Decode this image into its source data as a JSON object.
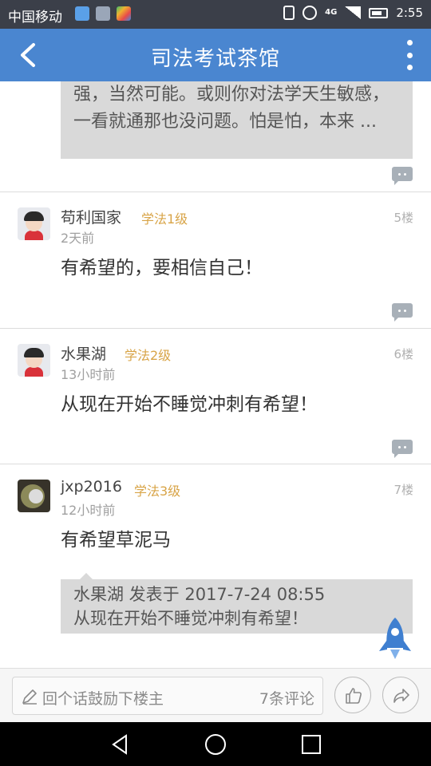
{
  "status_bar": {
    "carrier": "中国移动",
    "network": "4G",
    "time": "2:55"
  },
  "header": {
    "title": "司法考试茶馆",
    "back_icon": "chevron-left-icon",
    "more_icon": "more-vertical-icon"
  },
  "top_quote": {
    "text": "强，当然可能。或则你对法学天生敏感，一看就通那也没问题。怕是怕，本来 ..."
  },
  "posts": [
    {
      "username": "苟利国家",
      "level": "学法1级",
      "floor": "5楼",
      "time": "2天前",
      "text": "有希望的，要相信自己！"
    },
    {
      "username": "水果湖",
      "level": "学法2级",
      "floor": "6楼",
      "time": "13小时前",
      "text": "从现在开始不睡觉冲刺有希望！"
    },
    {
      "username": "jxp2016",
      "level": "学法3级",
      "floor": "7楼",
      "time": "12小时前",
      "text": "有希望草泥马",
      "reply": {
        "line1": "水果湖 发表于 2017-7-24 08:55",
        "line2": "从现在开始不睡觉冲刺有希望！"
      }
    }
  ],
  "bottom_bar": {
    "placeholder": "回个话鼓励下楼主",
    "comment_count": "7条评论"
  },
  "colors": {
    "header_bg": "#4a86d0",
    "level": "#d8a447",
    "rocket": "#3f7fd0"
  }
}
